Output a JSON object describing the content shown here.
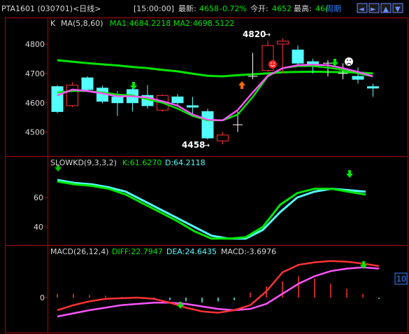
{
  "header": {
    "symbol": "PTA1601 (030701)<日线>",
    "time": "[15:00:00]",
    "last_label": "最新:",
    "last_value": "4658",
    "change": "-0.72%",
    "open_label": "今开:",
    "open_value": "4652",
    "high_label": "最高:",
    "high_value": "46(",
    "period_label": "周期",
    "nav_buttons": [
      "◄",
      "►",
      "▲",
      "▼"
    ]
  },
  "colors": {
    "up": "#ff3232",
    "down": "#54ffff",
    "ma1": "#ff54ff",
    "ma2": "#00e600",
    "k": "#00e600",
    "d": "#54ffff",
    "frame": "#b40000",
    "yellow": "#ffff00",
    "white": "#ffffff",
    "label_blue": "#2a7fff"
  },
  "kpanel": {
    "k_label": "K",
    "ma_label": "MA(5,8,60)",
    "ma1_text": "MA1:4684.2218",
    "ma2_text": "MA2:4698.5122",
    "y_ticks": [
      "4800",
      "4700",
      "4600",
      "4500"
    ],
    "high_annotation": "4820",
    "low_annotation": "4458",
    "candles": [
      {
        "o": 4655,
        "c": 4570,
        "h": 4660,
        "l": 4565
      },
      {
        "o": 4590,
        "c": 4660,
        "h": 4670,
        "l": 4585
      },
      {
        "o": 4685,
        "c": 4645,
        "h": 4690,
        "l": 4640
      },
      {
        "o": 4650,
        "c": 4605,
        "h": 4658,
        "l": 4598
      },
      {
        "o": 4620,
        "c": 4600,
        "h": 4640,
        "l": 4555
      },
      {
        "o": 4645,
        "c": 4600,
        "h": 4650,
        "l": 4570
      },
      {
        "o": 4625,
        "c": 4590,
        "h": 4660,
        "l": 4580
      },
      {
        "o": 4575,
        "c": 4625,
        "h": 4628,
        "l": 4570
      },
      {
        "o": 4620,
        "c": 4600,
        "h": 4630,
        "l": 4590
      },
      {
        "o": 4590,
        "c": 4585,
        "h": 4620,
        "l": 4560
      },
      {
        "o": 4570,
        "c": 4480,
        "h": 4580,
        "l": 4475
      },
      {
        "o": 4470,
        "c": 4490,
        "h": 4500,
        "l": 4458
      },
      {
        "o": 4525,
        "c": 4525,
        "h": 4570,
        "l": 4500
      },
      {
        "o": 4690,
        "c": 4690,
        "h": 4770,
        "l": 4680
      },
      {
        "o": 4710,
        "c": 4795,
        "h": 4812,
        "l": 4705
      },
      {
        "o": 4800,
        "c": 4810,
        "h": 4820,
        "l": 4700
      },
      {
        "o": 4780,
        "c": 4735,
        "h": 4795,
        "l": 4730
      },
      {
        "o": 4740,
        "c": 4725,
        "h": 4750,
        "l": 4700
      },
      {
        "o": 4735,
        "c": 4735,
        "h": 4745,
        "l": 4690
      },
      {
        "o": 4700,
        "c": 4700,
        "h": 4735,
        "l": 4680
      },
      {
        "o": 4690,
        "c": 4680,
        "h": 4720,
        "l": 4665
      },
      {
        "o": 4655,
        "c": 4650,
        "h": 4665,
        "l": 4620
      }
    ],
    "ma1_series": [
      4625,
      4645,
      4640,
      4632,
      4622,
      4622,
      4618,
      4605,
      4590,
      4560,
      4542,
      4540,
      4575,
      4635,
      4692,
      4718,
      4728,
      4730,
      4728,
      4718,
      4705,
      4690
    ],
    "ma2_series": [
      4635,
      4640,
      4640,
      4635,
      4628,
      4625,
      4612,
      4600,
      4580,
      4555,
      4540,
      4540,
      4560,
      4620,
      4690,
      4718,
      4725,
      4725,
      4720,
      4712,
      4700,
      4690
    ],
    "ma60_series": [
      4745,
      4740,
      4735,
      4731,
      4727,
      4722,
      4718,
      4712,
      4707,
      4699,
      4692,
      4690,
      4694,
      4697,
      4700,
      4704,
      4705,
      4706,
      4705,
      4704,
      4703,
      4700
    ]
  },
  "kdpanel": {
    "label": "SLOWKD(9,3,3,2)",
    "k_text": "K:61.6270",
    "d_text": "D:64.2118",
    "y_ticks": [
      "60",
      "40"
    ],
    "k_series": [
      71,
      69,
      68,
      66,
      62,
      56,
      50,
      44,
      37,
      32,
      32,
      33,
      40,
      55,
      63,
      66,
      66,
      64,
      62
    ],
    "d_series": [
      72,
      70,
      69,
      67,
      64,
      58,
      52,
      46,
      40,
      34,
      32,
      32,
      38,
      50,
      60,
      64,
      66,
      65,
      64
    ]
  },
  "macdpanel": {
    "label": "MACD(26,12,4)",
    "diff_text": "DIFF:22.7947",
    "dea_text": "DEA:24.6435",
    "macd_text": "MACD:-3.6976",
    "y_ticks": [
      "0"
    ],
    "side_badge": "10",
    "bars": [
      6,
      6,
      4,
      3,
      1,
      0,
      -2,
      -4,
      -6,
      -8,
      -6,
      -4,
      8,
      18,
      26,
      34,
      30,
      22,
      14,
      6,
      -2
    ],
    "diff_series": [
      -20,
      -12,
      -6,
      -2,
      -1,
      0,
      -2,
      -8,
      -16,
      -22,
      -24,
      -20,
      -12,
      10,
      40,
      52,
      56,
      58,
      57,
      54,
      50
    ],
    "dea_series": [
      -30,
      -25,
      -20,
      -16,
      -12,
      -10,
      -8,
      -8,
      -10,
      -14,
      -18,
      -20,
      -18,
      -10,
      6,
      22,
      34,
      42,
      46,
      48,
      46
    ]
  }
}
